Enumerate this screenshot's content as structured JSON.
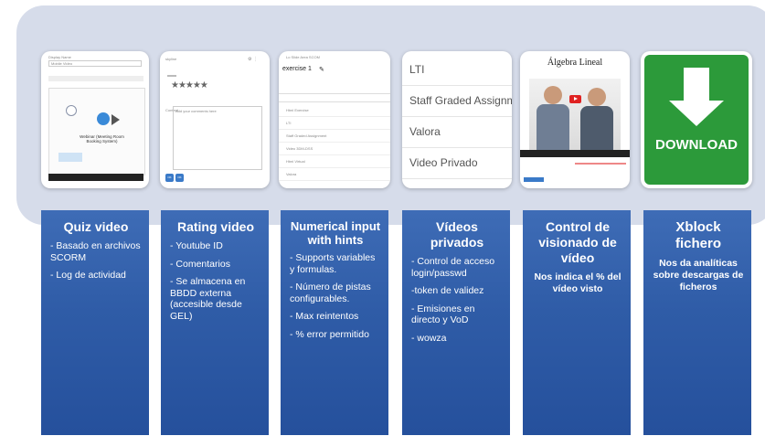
{
  "thumbnails": {
    "quiz": {
      "field1_label": "Display Name",
      "field1_value": "Mobile Video",
      "caption": "Webinar (Meeting Room Booking System)"
    },
    "rating": {
      "header": "skyline",
      "stars": "★★★★★",
      "comment_label": "Content",
      "comment_placeholder": "Add your comments here",
      "btn1": "OK",
      "btn2": "OK"
    },
    "numerical": {
      "crumb": "Lo Slide Area SCOM",
      "title": "exercise 1",
      "rows": [
        "Html Exercise",
        "LTI",
        "Staff Graded Assignment",
        "Video 3DM-DSS",
        "Html Virtual",
        "Valora",
        "Video Privado"
      ]
    },
    "lti_list": {
      "items": [
        "LTI",
        "Staff Graded Assignmen",
        "Valora",
        "Video Privado"
      ]
    },
    "video": {
      "title": "Álgebra Lineal"
    },
    "download": {
      "label": "DOWNLOAD"
    }
  },
  "columns": [
    {
      "title": "Quiz video",
      "items": [
        "- Basado en archivos SCORM",
        "- Log de actividad"
      ]
    },
    {
      "title": "Rating video",
      "items": [
        "- Youtube ID",
        "- Comentarios",
        "- Se almacena en BBDD externa (accesible desde GEL)"
      ]
    },
    {
      "title": "Numerical input with hints",
      "items": [
        "- Supports variables y formulas.",
        "- Número de pistas configurables.",
        "- Max reintentos",
        "- % error permitido"
      ]
    },
    {
      "title": "Vídeos privados",
      "items": [
        "- Control de acceso login/passwd",
        "-token de validez",
        "- Emisiones en directo y VoD",
        "- wowza"
      ]
    },
    {
      "title": "Control de visionado de vídeo",
      "text": "Nos indica el % del vídeo visto"
    },
    {
      "title": "Xblock fichero",
      "text": "Nos da analíticas sobre descargas de ficheros"
    }
  ]
}
